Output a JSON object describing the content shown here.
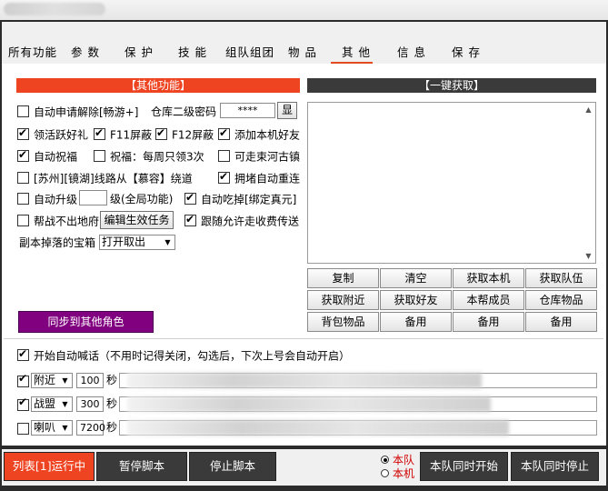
{
  "tabs": [
    {
      "label": "所有功能"
    },
    {
      "label": "参 数"
    },
    {
      "label": "保 护"
    },
    {
      "label": "技 能"
    },
    {
      "label": "组队组团"
    },
    {
      "label": "物 品"
    },
    {
      "label": "其 他"
    },
    {
      "label": "信 息"
    },
    {
      "label": "保 存"
    }
  ],
  "other_section": {
    "header": "【其他功能】",
    "auto_unlock": {
      "label": "自动申请解除[畅游+]",
      "checked": false
    },
    "warehouse_label": "仓库二级密码",
    "warehouse_value": "****",
    "show_btn": "显",
    "active_gift": {
      "label": "领活跃好礼",
      "checked": true
    },
    "f11": {
      "label": "F11屏蔽",
      "checked": true
    },
    "f12": {
      "label": "F12屏蔽",
      "checked": true
    },
    "add_friend": {
      "label": "添加本机好友",
      "checked": true
    },
    "auto_bless": {
      "label": "自动祝福",
      "checked": true
    },
    "bless_weekly": {
      "label": "祝福：每周只领3次",
      "checked": false
    },
    "east_river": {
      "label": "可走束河古镇",
      "checked": false
    },
    "route_detour": {
      "label": "[苏州][镜湖]线路从【慕容】绕道",
      "checked": false
    },
    "jam_reconnect": {
      "label": "拥堵自动重连",
      "checked": true
    },
    "auto_upgrade": {
      "label": "自动升级",
      "checked": false
    },
    "upgrade_level_value": "",
    "upgrade_level_suffix": "级(全局功能)",
    "auto_eat": {
      "label": "自动吃掉[绑定真元]",
      "checked": true
    },
    "guild_stay": {
      "label": "帮战不出地府",
      "checked": false
    },
    "edit_task_btn": "编辑生效任务",
    "follow_paid": {
      "label": "跟随允许走收费传送",
      "checked": true
    },
    "dungeon_chest_label": "副本掉落的宝箱",
    "dungeon_chest_value": "打开取出",
    "sync_btn": "同步到其他角色"
  },
  "fetch_section": {
    "header": "【一键获取】",
    "buttons": [
      "复制",
      "清空",
      "获取本机",
      "获取队伍",
      "获取附近",
      "获取好友",
      "本帮成员",
      "仓库物品",
      "背包物品",
      "备用",
      "备用",
      "备用"
    ]
  },
  "shout": {
    "enable": {
      "label": "开始自动喊话（不用时记得关闭，勾选后，下次上号会自动开启）",
      "checked": true
    },
    "rows": [
      {
        "checked": true,
        "channel": "附近",
        "interval": "100",
        "unit": "秒"
      },
      {
        "checked": true,
        "channel": "战盟",
        "interval": "300",
        "unit": "秒"
      },
      {
        "checked": false,
        "channel": "喇叭",
        "interval": "7200",
        "unit": "秒"
      }
    ]
  },
  "bottom": {
    "list_run": "列表[1]运行中",
    "pause": "暂停脚本",
    "stop": "停止脚本",
    "radio_team": "本队",
    "radio_local": "本机",
    "team_start": "本队同时开始",
    "team_stop": "本队同时停止"
  }
}
